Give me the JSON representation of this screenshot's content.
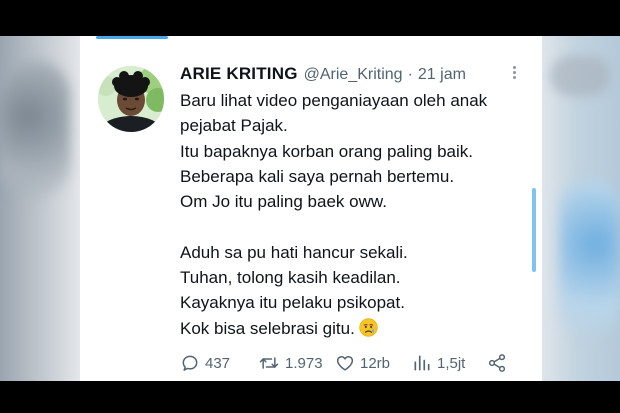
{
  "tweet": {
    "author_name": "ARIE KRITING",
    "handle": "@Arie_Kriting",
    "separator": "·",
    "time": "21 jam",
    "lines": [
      "Baru lihat video penganiayaan oleh anak",
      "pejabat Pajak.",
      "Itu bapaknya korban orang paling baik.",
      "Beberapa kali saya pernah bertemu.",
      "Om Jo itu paling baek oww.",
      "",
      "Aduh sa pu hati hancur sekali.",
      "Tuhan, tolong kasih keadilan.",
      "Kayaknya itu pelaku psikopat.",
      "Kok bisa selebrasi gitu."
    ],
    "emoji": "crying-face"
  },
  "actions": {
    "reply_count": "437",
    "retweet_count": "1.973",
    "like_count": "12rb",
    "views_count": "1,5jt"
  },
  "colors": {
    "accent": "#1d9bf0",
    "text_primary": "#0f1419",
    "text_secondary": "#536471"
  },
  "icons": [
    "more-options-icon",
    "reply-icon",
    "retweet-icon",
    "like-icon",
    "views-icon",
    "share-icon",
    "crying-face-emoji"
  ]
}
